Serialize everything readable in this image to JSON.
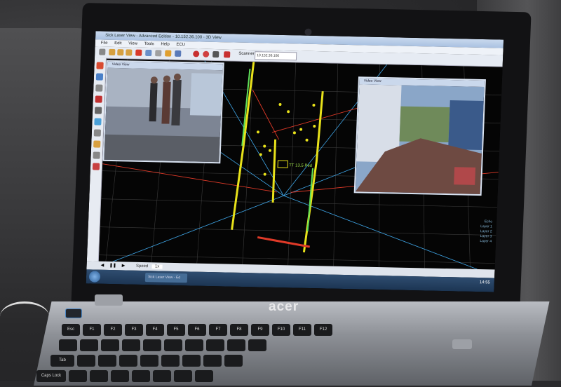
{
  "window": {
    "title": "Sick Laser View - Advanced Edition - 10.152.36.100 - 3D View",
    "menus": [
      "File",
      "Edit",
      "View",
      "Tools",
      "Help",
      "ECU"
    ]
  },
  "toolbar": {
    "scanner_label": "Scanner IP:",
    "scanner_value": "10.152.36.100"
  },
  "video_left": {
    "title": "Video View"
  },
  "video_right": {
    "title": "Video View"
  },
  "overlay": {
    "object_label": "TT 13.5 Ped"
  },
  "bottombar": {
    "speed_label": "Speed",
    "speed_value": "1x"
  },
  "legend": {
    "items": [
      "Echo",
      "Layer 1",
      "Layer 2",
      "Layer 3",
      "Layer 4"
    ]
  },
  "taskbar": {
    "task_label": "Sick Laser View - Ed",
    "clock": "14:55"
  },
  "brand": "acer",
  "keyboard": {
    "row1": [
      "Esc",
      "F1",
      "F2",
      "F3",
      "F4",
      "F5",
      "F6",
      "F7",
      "F8",
      "F9",
      "F10",
      "F11",
      "F12"
    ],
    "row_labels": [
      "Tab",
      "Caps Lock"
    ]
  },
  "colors": {
    "grid": "#3a3a3a",
    "lane_yellow": "#e8e21a",
    "lane_green": "#5fe05a",
    "ray_blue": "#3fa6e8",
    "ray_red": "#e03a28",
    "window_chrome": "#c9d9ee"
  }
}
